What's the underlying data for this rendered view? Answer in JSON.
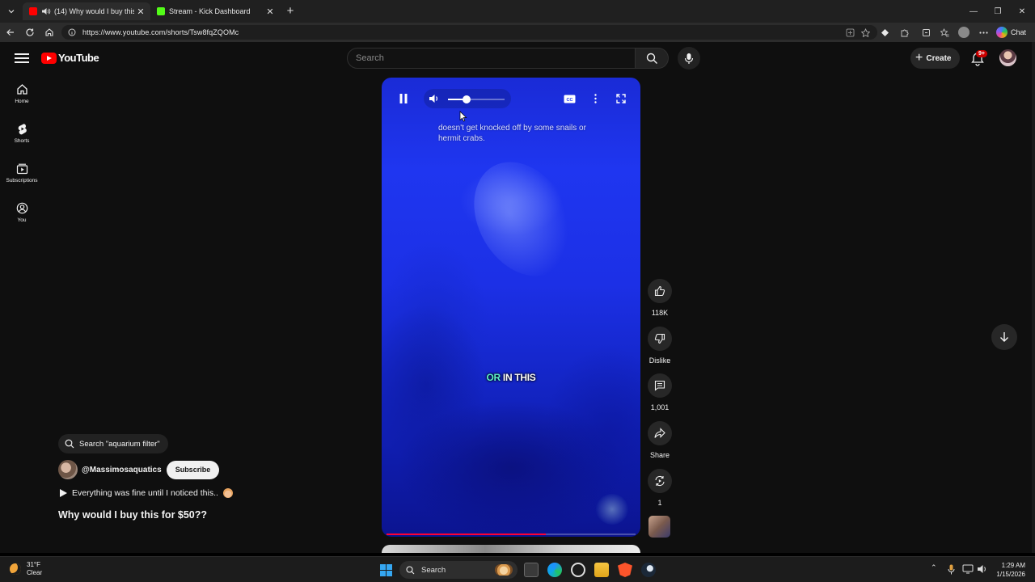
{
  "browser": {
    "tabs": [
      {
        "title": "(14) Why would I buy this for",
        "favicon_color": "#ff0000",
        "active": true
      },
      {
        "title": "Stream - Kick Dashboard",
        "favicon_color": "#53fc18",
        "active": false
      }
    ],
    "url": "https://www.youtube.com/shorts/Tsw8fqZQOMc",
    "chat_label": "Chat"
  },
  "header": {
    "logo_text": "YouTube",
    "search_placeholder": "Search",
    "create_label": "Create",
    "notification_badge": "9+"
  },
  "sidebar": {
    "items": [
      {
        "label": "Home",
        "icon": "home-icon"
      },
      {
        "label": "Shorts",
        "icon": "shorts-icon"
      },
      {
        "label": "Subscriptions",
        "icon": "subscriptions-icon"
      },
      {
        "label": "You",
        "icon": "you-icon"
      }
    ]
  },
  "player": {
    "volume_level": 0.33,
    "playback_progress": 0.64,
    "caption_text": "doesn't get knocked off by some snails or hermit crabs.",
    "burned_caption_highlight": "OR",
    "burned_caption_rest": " IN THIS",
    "cc_label": "CC"
  },
  "actions": {
    "likes": "118K",
    "dislike_label": "Dislike",
    "comments": "1,001",
    "share_label": "Share",
    "remix_count": "1"
  },
  "info": {
    "search_suggestion": "Search \"aquarium filter\"",
    "channel": "@Massimosaquatics",
    "subscribe_label": "Subscribe",
    "description": "Everything was fine until I noticed this..",
    "title": "Why would I buy this for $50??"
  },
  "taskbar": {
    "temperature": "31°F",
    "condition": "Clear",
    "search_label": "Search",
    "time": "1:29 AM",
    "date": "1/15/2026"
  },
  "colors": {
    "accent_red": "#ff0000",
    "video_blue": "#1f36f0",
    "highlight_teal": "#5ef2c8"
  }
}
